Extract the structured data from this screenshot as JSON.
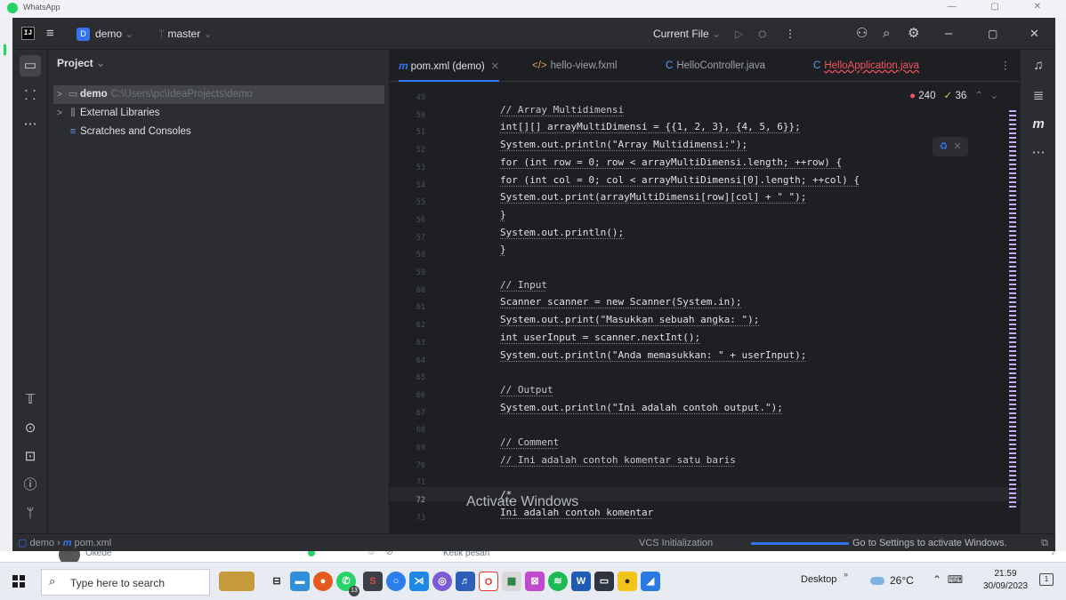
{
  "window_behind": {
    "title": "WhatsApp"
  },
  "titlebar": {
    "project_letter": "D",
    "project_name": "demo",
    "branch": "master",
    "run_config": "Current File"
  },
  "project_panel": {
    "header": "Project",
    "items": [
      {
        "label": "demo",
        "path": "C:\\Users\\pc\\IdeaProjects\\demo"
      },
      {
        "label": "External Libraries"
      },
      {
        "label": "Scratches and Consoles"
      }
    ]
  },
  "tabs": [
    {
      "label": "pom.xml (demo)",
      "icon": "m"
    },
    {
      "label": "hello-view.fxml",
      "icon": "</>"
    },
    {
      "label": "HelloController.java",
      "icon": "C"
    },
    {
      "label": "HelloApplication.java",
      "icon": "C"
    }
  ],
  "inspections": {
    "errors": "240",
    "warnings": "36"
  },
  "code": {
    "line_numbers": [
      "49",
      "50",
      "51",
      "52",
      "53",
      "54",
      "55",
      "56",
      "57",
      "58",
      "59",
      "60",
      "61",
      "62",
      "63",
      "64",
      "65",
      "66",
      "67",
      "68",
      "69",
      "70",
      "71",
      "72",
      "73"
    ],
    "current_line": "72",
    "lines": [
      "",
      "// Array Multidimensi",
      "int[][] arrayMultiDimensi = {{1, 2, 3}, {4, 5, 6}};",
      "System.out.println(\"Array Multidimensi:\");",
      "for (int row = 0; row < arrayMultiDimensi.length; ++row) {",
      "for (int col = 0; col < arrayMultiDimensi[0].length; ++col) {",
      "System.out.print(arrayMultiDimensi[row][col] + \" \");",
      "}",
      "System.out.println();",
      "}",
      "",
      "// Input",
      "Scanner scanner = new Scanner(System.in);",
      "System.out.print(\"Masukkan sebuah angka: \");",
      "int userInput = scanner.nextInt();",
      "System.out.println(\"Anda memasukkan: \" + userInput);",
      "",
      "// Output",
      "System.out.println(\"Ini adalah contoh output.\");",
      "",
      "// Comment",
      "// Ini adalah contoh komentar satu baris",
      "",
      "/*",
      "Ini adalah contoh komentar"
    ]
  },
  "watermark": {
    "activate_title": "Activate Windows"
  },
  "statusbar": {
    "crumb_project": "demo",
    "crumb_file": "pom.xml",
    "vcs": "VCS Initialization",
    "right_text": "Go to Settings to activate Windows."
  },
  "whatsapp_strip": {
    "contact": "Okede",
    "input_placeholder": "Ketik pesan"
  },
  "taskbar": {
    "search_placeholder": "Type here to search",
    "badge_count": "13",
    "desktop": "Desktop",
    "temperature": "26°C",
    "time": "21.59",
    "date": "30/09/2023",
    "notification_count": "1"
  }
}
